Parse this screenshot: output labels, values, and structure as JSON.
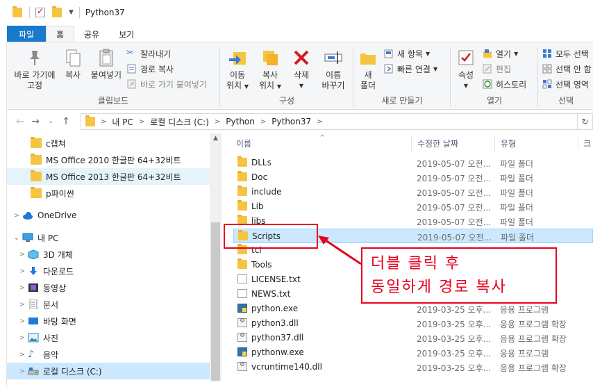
{
  "window": {
    "title": "Python37"
  },
  "tabs": [
    {
      "label": "파일",
      "kind": "file"
    },
    {
      "label": "홈",
      "kind": "active"
    },
    {
      "label": "공유",
      "kind": ""
    },
    {
      "label": "보기",
      "kind": ""
    }
  ],
  "ribbon": {
    "clipboard": {
      "label": "클립보드",
      "pin_line1": "바로 가기에",
      "pin_line2": "고정",
      "copy": "복사",
      "paste": "붙여넣기",
      "cut": "잘라내기",
      "copy_path": "경로 복사",
      "paste_shortcut": "바로 가기 붙여넣기"
    },
    "organize": {
      "label": "구성",
      "move_line1": "이동",
      "move_line2": "위치",
      "copy_line1": "복사",
      "copy_line2": "위치",
      "delete": "삭제",
      "rename_line1": "이름",
      "rename_line2": "바꾸기"
    },
    "new": {
      "label": "새로 만들기",
      "new_folder_line1": "새",
      "new_folder_line2": "폴더",
      "new_item": "새 항목",
      "easy_access": "빠른 연결"
    },
    "open": {
      "label": "열기",
      "properties": "속성",
      "open": "열기",
      "edit": "편집",
      "history": "히스토리"
    },
    "select": {
      "label": "선택",
      "select_all": "모두 선택",
      "select_none": "선택 안 함",
      "invert": "선택 영역"
    }
  },
  "address": {
    "crumbs": [
      "내 PC",
      "로컬 디스크 (C:)",
      "Python",
      "Python37"
    ]
  },
  "nav": {
    "items": [
      {
        "label": "c캡쳐",
        "icon": "folder-icon",
        "state": ""
      },
      {
        "label": "MS Office 2010 한글판 64+32비트",
        "icon": "folder-icon",
        "state": ""
      },
      {
        "label": "MS Office 2013 한글판 64+32비트",
        "icon": "folder-icon",
        "state": "hl"
      },
      {
        "label": "p파이썬",
        "icon": "folder-icon",
        "state": ""
      },
      {
        "label": "OneDrive",
        "icon": "cloud-icon",
        "state": ""
      },
      {
        "label": "내 PC",
        "icon": "computer-icon",
        "state": ""
      },
      {
        "label": "3D 개체",
        "icon": "cube-icon",
        "state": ""
      },
      {
        "label": "다운로드",
        "icon": "download-icon",
        "state": ""
      },
      {
        "label": "동영상",
        "icon": "video-icon",
        "state": ""
      },
      {
        "label": "문서",
        "icon": "document-icon",
        "state": ""
      },
      {
        "label": "바탕 화면",
        "icon": "desktop-icon",
        "state": ""
      },
      {
        "label": "사진",
        "icon": "picture-icon",
        "state": ""
      },
      {
        "label": "음악",
        "icon": "music-icon",
        "state": ""
      },
      {
        "label": "로컬 디스크 (C:)",
        "icon": "drive-icon",
        "state": "sel"
      }
    ]
  },
  "list": {
    "headers": {
      "name": "이름",
      "date": "수정한 날짜",
      "type": "유형",
      "size": "크"
    },
    "rows": [
      {
        "name": "DLLs",
        "date": "2019-05-07 오전...",
        "type": "파일 폴더",
        "icon": "folder-icon"
      },
      {
        "name": "Doc",
        "date": "2019-05-07 오전...",
        "type": "파일 폴더",
        "icon": "folder-icon"
      },
      {
        "name": "include",
        "date": "2019-05-07 오전...",
        "type": "파일 폴더",
        "icon": "folder-icon"
      },
      {
        "name": "Lib",
        "date": "2019-05-07 오전...",
        "type": "파일 폴더",
        "icon": "folder-icon"
      },
      {
        "name": "libs",
        "date": "2019-05-07 오전...",
        "type": "파일 폴더",
        "icon": "folder-icon"
      },
      {
        "name": "Scripts",
        "date": "2019-05-07 오전...",
        "type": "파일 폴더",
        "icon": "folder-icon",
        "selected": true
      },
      {
        "name": "tcl",
        "date": "",
        "type": "",
        "icon": "folder-icon"
      },
      {
        "name": "Tools",
        "date": "",
        "type": "",
        "icon": "folder-icon"
      },
      {
        "name": "LICENSE.txt",
        "date": "",
        "type": "",
        "icon": "text-file-icon"
      },
      {
        "name": "NEWS.txt",
        "date": "",
        "type": "",
        "icon": "text-file-icon"
      },
      {
        "name": "python.exe",
        "date": "2019-03-25 오후...",
        "type": "응용 프로그램",
        "icon": "exe-icon"
      },
      {
        "name": "python3.dll",
        "date": "2019-03-25 오후...",
        "type": "응용 프로그램 확장",
        "icon": "dll-icon"
      },
      {
        "name": "python37.dll",
        "date": "2019-03-25 오후...",
        "type": "응용 프로그램 확장",
        "icon": "dll-icon"
      },
      {
        "name": "pythonw.exe",
        "date": "2019-03-25 오후...",
        "type": "응용 프로그램",
        "icon": "exe-icon"
      },
      {
        "name": "vcruntime140.dll",
        "date": "2019-03-25 오후...",
        "type": "응용 프로그램 확장",
        "icon": "dll-icon"
      }
    ]
  },
  "annotation": {
    "line1": "더블 클릭 후",
    "line2": "동일하게 경로 복사",
    "color": "#e8001c"
  }
}
